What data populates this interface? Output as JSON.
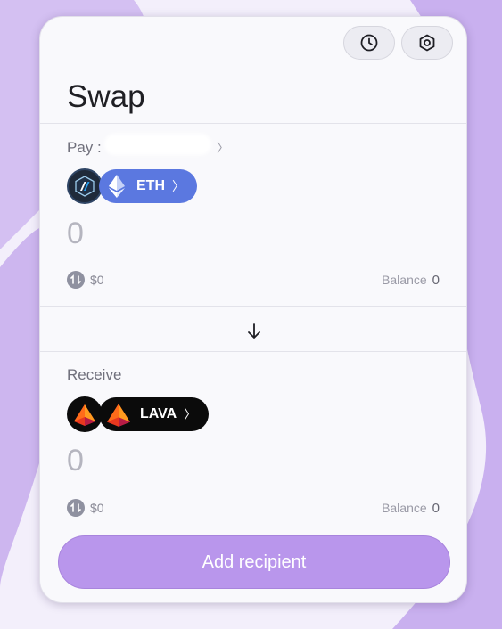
{
  "header": {
    "title": "Swap",
    "history_icon": "clock-icon",
    "settings_icon": "hexagon-settings-icon"
  },
  "pay": {
    "label": "Pay :",
    "chain_icon": "arbitrum-logo",
    "token_icon": "ethereum-logo",
    "token_symbol": "ETH",
    "amount": "0",
    "usd_value": "$0",
    "balance_label": "Balance",
    "balance_value": "0",
    "pill_color": "#5b78e0"
  },
  "receive": {
    "label": "Receive",
    "chain_icon": "lava-logo",
    "token_icon": "lava-logo",
    "token_symbol": "LAVA",
    "amount": "0",
    "usd_value": "$0",
    "balance_label": "Balance",
    "balance_value": "0",
    "pill_color": "#0b0b0b"
  },
  "swap_direction_icon": "arrow-down-icon",
  "cta": {
    "label": "Add recipient",
    "color": "#b996ec"
  }
}
